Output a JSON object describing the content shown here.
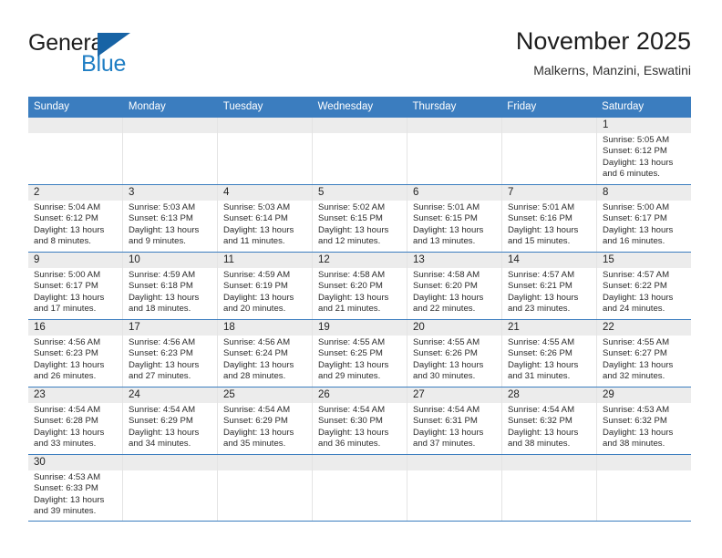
{
  "brand": {
    "name_top": "General",
    "name_bottom": "Blue",
    "accent_color": "#1f7ec4",
    "triangle_color": "#1763a5"
  },
  "header": {
    "title": "November 2025",
    "subtitle": "Malkerns, Manzini, Eswatini"
  },
  "theme": {
    "header_row_bg": "#3b7dbf",
    "day_number_bg": "#ececec",
    "cell_border": "#e4e4e4",
    "week_separator": "#3b7dbf"
  },
  "weekdays": [
    "Sunday",
    "Monday",
    "Tuesday",
    "Wednesday",
    "Thursday",
    "Friday",
    "Saturday"
  ],
  "weeks": [
    [
      {
        "day": "",
        "lines": []
      },
      {
        "day": "",
        "lines": []
      },
      {
        "day": "",
        "lines": []
      },
      {
        "day": "",
        "lines": []
      },
      {
        "day": "",
        "lines": []
      },
      {
        "day": "",
        "lines": []
      },
      {
        "day": "1",
        "lines": [
          "Sunrise: 5:05 AM",
          "Sunset: 6:12 PM",
          "Daylight: 13 hours",
          "and 6 minutes."
        ]
      }
    ],
    [
      {
        "day": "2",
        "lines": [
          "Sunrise: 5:04 AM",
          "Sunset: 6:12 PM",
          "Daylight: 13 hours",
          "and 8 minutes."
        ]
      },
      {
        "day": "3",
        "lines": [
          "Sunrise: 5:03 AM",
          "Sunset: 6:13 PM",
          "Daylight: 13 hours",
          "and 9 minutes."
        ]
      },
      {
        "day": "4",
        "lines": [
          "Sunrise: 5:03 AM",
          "Sunset: 6:14 PM",
          "Daylight: 13 hours",
          "and 11 minutes."
        ]
      },
      {
        "day": "5",
        "lines": [
          "Sunrise: 5:02 AM",
          "Sunset: 6:15 PM",
          "Daylight: 13 hours",
          "and 12 minutes."
        ]
      },
      {
        "day": "6",
        "lines": [
          "Sunrise: 5:01 AM",
          "Sunset: 6:15 PM",
          "Daylight: 13 hours",
          "and 13 minutes."
        ]
      },
      {
        "day": "7",
        "lines": [
          "Sunrise: 5:01 AM",
          "Sunset: 6:16 PM",
          "Daylight: 13 hours",
          "and 15 minutes."
        ]
      },
      {
        "day": "8",
        "lines": [
          "Sunrise: 5:00 AM",
          "Sunset: 6:17 PM",
          "Daylight: 13 hours",
          "and 16 minutes."
        ]
      }
    ],
    [
      {
        "day": "9",
        "lines": [
          "Sunrise: 5:00 AM",
          "Sunset: 6:17 PM",
          "Daylight: 13 hours",
          "and 17 minutes."
        ]
      },
      {
        "day": "10",
        "lines": [
          "Sunrise: 4:59 AM",
          "Sunset: 6:18 PM",
          "Daylight: 13 hours",
          "and 18 minutes."
        ]
      },
      {
        "day": "11",
        "lines": [
          "Sunrise: 4:59 AM",
          "Sunset: 6:19 PM",
          "Daylight: 13 hours",
          "and 20 minutes."
        ]
      },
      {
        "day": "12",
        "lines": [
          "Sunrise: 4:58 AM",
          "Sunset: 6:20 PM",
          "Daylight: 13 hours",
          "and 21 minutes."
        ]
      },
      {
        "day": "13",
        "lines": [
          "Sunrise: 4:58 AM",
          "Sunset: 6:20 PM",
          "Daylight: 13 hours",
          "and 22 minutes."
        ]
      },
      {
        "day": "14",
        "lines": [
          "Sunrise: 4:57 AM",
          "Sunset: 6:21 PM",
          "Daylight: 13 hours",
          "and 23 minutes."
        ]
      },
      {
        "day": "15",
        "lines": [
          "Sunrise: 4:57 AM",
          "Sunset: 6:22 PM",
          "Daylight: 13 hours",
          "and 24 minutes."
        ]
      }
    ],
    [
      {
        "day": "16",
        "lines": [
          "Sunrise: 4:56 AM",
          "Sunset: 6:23 PM",
          "Daylight: 13 hours",
          "and 26 minutes."
        ]
      },
      {
        "day": "17",
        "lines": [
          "Sunrise: 4:56 AM",
          "Sunset: 6:23 PM",
          "Daylight: 13 hours",
          "and 27 minutes."
        ]
      },
      {
        "day": "18",
        "lines": [
          "Sunrise: 4:56 AM",
          "Sunset: 6:24 PM",
          "Daylight: 13 hours",
          "and 28 minutes."
        ]
      },
      {
        "day": "19",
        "lines": [
          "Sunrise: 4:55 AM",
          "Sunset: 6:25 PM",
          "Daylight: 13 hours",
          "and 29 minutes."
        ]
      },
      {
        "day": "20",
        "lines": [
          "Sunrise: 4:55 AM",
          "Sunset: 6:26 PM",
          "Daylight: 13 hours",
          "and 30 minutes."
        ]
      },
      {
        "day": "21",
        "lines": [
          "Sunrise: 4:55 AM",
          "Sunset: 6:26 PM",
          "Daylight: 13 hours",
          "and 31 minutes."
        ]
      },
      {
        "day": "22",
        "lines": [
          "Sunrise: 4:55 AM",
          "Sunset: 6:27 PM",
          "Daylight: 13 hours",
          "and 32 minutes."
        ]
      }
    ],
    [
      {
        "day": "23",
        "lines": [
          "Sunrise: 4:54 AM",
          "Sunset: 6:28 PM",
          "Daylight: 13 hours",
          "and 33 minutes."
        ]
      },
      {
        "day": "24",
        "lines": [
          "Sunrise: 4:54 AM",
          "Sunset: 6:29 PM",
          "Daylight: 13 hours",
          "and 34 minutes."
        ]
      },
      {
        "day": "25",
        "lines": [
          "Sunrise: 4:54 AM",
          "Sunset: 6:29 PM",
          "Daylight: 13 hours",
          "and 35 minutes."
        ]
      },
      {
        "day": "26",
        "lines": [
          "Sunrise: 4:54 AM",
          "Sunset: 6:30 PM",
          "Daylight: 13 hours",
          "and 36 minutes."
        ]
      },
      {
        "day": "27",
        "lines": [
          "Sunrise: 4:54 AM",
          "Sunset: 6:31 PM",
          "Daylight: 13 hours",
          "and 37 minutes."
        ]
      },
      {
        "day": "28",
        "lines": [
          "Sunrise: 4:54 AM",
          "Sunset: 6:32 PM",
          "Daylight: 13 hours",
          "and 38 minutes."
        ]
      },
      {
        "day": "29",
        "lines": [
          "Sunrise: 4:53 AM",
          "Sunset: 6:32 PM",
          "Daylight: 13 hours",
          "and 38 minutes."
        ]
      }
    ],
    [
      {
        "day": "30",
        "lines": [
          "Sunrise: 4:53 AM",
          "Sunset: 6:33 PM",
          "Daylight: 13 hours",
          "and 39 minutes."
        ]
      },
      {
        "day": "",
        "lines": []
      },
      {
        "day": "",
        "lines": []
      },
      {
        "day": "",
        "lines": []
      },
      {
        "day": "",
        "lines": []
      },
      {
        "day": "",
        "lines": []
      },
      {
        "day": "",
        "lines": []
      }
    ]
  ]
}
